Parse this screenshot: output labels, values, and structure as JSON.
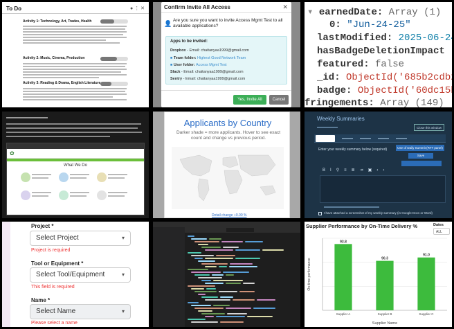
{
  "tile1": {
    "title": "To Do",
    "section1": "Activity 1: Technology, Art, Trades, Health",
    "section2": "Activity 2: Music, Cinema, Production",
    "section3": "Activity 3: Reading & Drama, English Literature"
  },
  "tile2": {
    "header": "Confirm Invite All Access",
    "question": "Are you sure you want to invite Access Mgmt Test to all available applications?",
    "apps_title": "Apps to be invited:",
    "items": [
      {
        "app": "Dropbox",
        "detail": "Email: chaitanyaa1999@gmail.com"
      },
      {
        "app": "Team folder:",
        "detail": "Highest Good Network Team"
      },
      {
        "app": "User folder:",
        "detail": "Access Mgmt Test"
      },
      {
        "app": "Slack",
        "detail": "Email: chaitanyaa1999@gmail.com"
      },
      {
        "app": "Sentry",
        "detail": "Email: chaitanyaa1999@gmail.com"
      }
    ],
    "confirm_label": "Yes, Invite All",
    "cancel_label": "Cancel"
  },
  "tile3": {
    "lines": [
      {
        "key": "earnedDate",
        "value": "Array (1)"
      },
      {
        "key": "0",
        "value": "\"Jun-24-25\""
      },
      {
        "key": "lastModified",
        "value": "2025-06-24"
      },
      {
        "key": "hasBadgeDeletionImpact",
        "value": ""
      },
      {
        "key": "featured",
        "value": "false"
      },
      {
        "key": "_id",
        "value": "ObjectId('685b2cdb2"
      },
      {
        "key": "badge",
        "value": "ObjectId('60dc15b"
      },
      {
        "key": "fringements",
        "value": "Array (149)"
      }
    ]
  },
  "tile4": {
    "heading": "What We Do"
  },
  "tile5": {
    "title": "Applicants by Country",
    "subtitle": "Darker shade = more applicants. Hover to see exact count and change vs previous period.",
    "link": "Detail change +0.00 %"
  },
  "tile6": {
    "title": "Weekly Summaries",
    "save_label": "Save",
    "close_label": "Close this window",
    "option": "Use of Daily Summit (RTT panel)",
    "prompt": "Enter your weekly summary below (required)",
    "checkbox": "I have attached a screenshot of my weekly summary (in Google Docs or Word)"
  },
  "tile7": {
    "project_label": "Project *",
    "project_value": "Select Project",
    "project_error": "Project is required",
    "tool_label": "Tool or Equipment *",
    "tool_value": "Select Tool/Equipment",
    "tool_error": "This field is required",
    "name_label": "Name *",
    "name_value": "Select Name",
    "name_error": "Please select a name"
  },
  "tile9": {
    "chart_data": {
      "type": "bar",
      "title": "Supplier Performance by On-Time Delivery %",
      "categories": [
        "Supplier A",
        "Supplier B",
        "Supplier C"
      ],
      "values": [
        93.8,
        90.3,
        91.0
      ],
      "xlabel": "Supplier Name",
      "ylabel": "On-time performance",
      "ylim": [
        80,
        95
      ],
      "color": "#3dbb3d",
      "grid": true
    },
    "dates_label": "Dates",
    "dates_value": "ALL"
  }
}
